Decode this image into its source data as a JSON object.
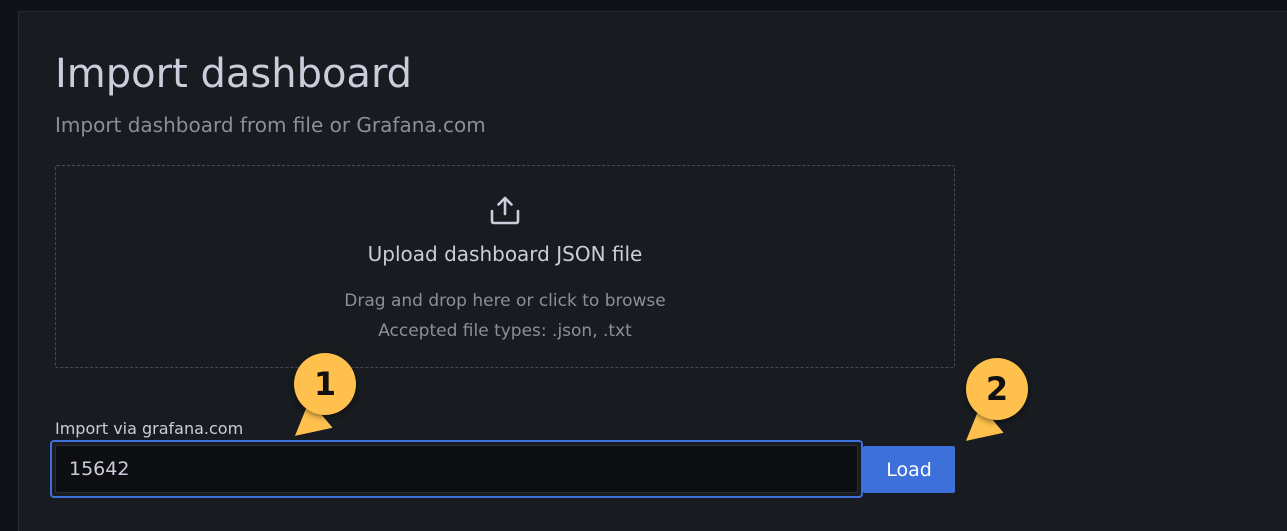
{
  "header": {
    "title": "Import dashboard",
    "subtitle": "Import dashboard from file or Grafana.com"
  },
  "upload": {
    "icon": "upload-icon",
    "title": "Upload dashboard JSON file",
    "hint": "Drag and drop here or click to browse",
    "types": "Accepted file types: .json, .txt"
  },
  "import_grafana": {
    "label": "Import via grafana.com",
    "value": "15642",
    "button_label": "Load"
  },
  "callouts": [
    "1",
    "2"
  ],
  "colors": {
    "accent": "#3d71d9",
    "callout": "#ffc04d",
    "panel_bg": "#181b1f",
    "page_bg": "#111217"
  }
}
